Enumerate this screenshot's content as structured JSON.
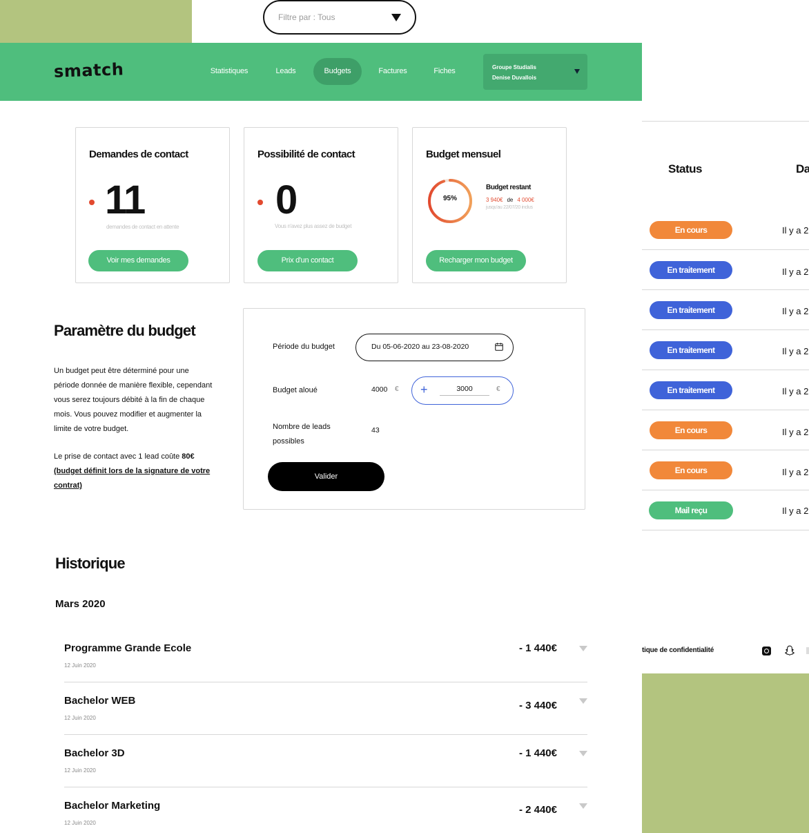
{
  "filter": {
    "placeholder": "Filtre par : Tous"
  },
  "header": {
    "logo": "smatch",
    "nav": [
      {
        "label": "Statistiques",
        "active": false
      },
      {
        "label": "Leads",
        "active": false
      },
      {
        "label": "Budgets",
        "active": true
      },
      {
        "label": "Factures",
        "active": false
      },
      {
        "label": "Fiches",
        "active": false
      }
    ],
    "account": {
      "company": "Groupe Studialis",
      "user": "Denise Duvallois"
    }
  },
  "cards": {
    "contact_requests": {
      "title": "Demandes de contact",
      "value": "11",
      "caption": "demandes de contact en attente",
      "button": "Voir mes demandes"
    },
    "contact_possibility": {
      "title": "Possibilité de contact",
      "value": "0",
      "caption": "Vous n'avez plus assez de budget",
      "button": "Prix d'un contact"
    },
    "monthly_budget": {
      "title": "Budget mensuel",
      "percent_label": "95%",
      "percent_value": 0.95,
      "remaining_label": "Budget restant",
      "remaining_amount": "3 940€",
      "of_label": "de",
      "total_amount": "4 000€",
      "until": "jusqu'au 22/07/20 inclus",
      "button": "Recharger mon budget"
    }
  },
  "budget_settings": {
    "title": "Paramètre du budget",
    "description": "Un budget peut être déterminé pour une période donnée de manière flexible, cependant vous serez toujours débité à la fin de chaque mois. Vous pouvez modifier et augmenter la limite de votre budget.",
    "cost_prefix": "Le prise de contact avec 1 lead coûte ",
    "cost_value": "80€",
    "cost_note": "(budget définit lors de la signature de votre contrat)",
    "period_label": "Période du budget",
    "period_value": "Du 05-06-2020 au 23-08-2020",
    "allocated_label": "Budget aloué",
    "allocated_value": "4000",
    "currency": "€",
    "add_value": "3000",
    "leads_label": "Nombre de leads possibles",
    "leads_value": "43",
    "submit": "Valider"
  },
  "history": {
    "title": "Historique",
    "month": "Mars 2020",
    "rows": [
      {
        "name": "Programme Grande Ecole",
        "date": "12 Juin 2020",
        "amount": "- 1 440€"
      },
      {
        "name": "Bachelor WEB",
        "date": "12 Juin 2020",
        "amount": "- 3 440€"
      },
      {
        "name": "Bachelor 3D",
        "date": "12 Juin 2020",
        "amount": "- 1 440€"
      },
      {
        "name": "Bachelor Marketing",
        "date": "12 Juin 2020",
        "amount": "- 2 440€"
      }
    ]
  },
  "status_table": {
    "status_header": "Status",
    "date_header": "Da",
    "rows": [
      {
        "status": "En cours",
        "ago": "Il y a 2"
      },
      {
        "status": "En traitement",
        "ago": "Il y a 2"
      },
      {
        "status": "En traitement",
        "ago": "Il y a 2"
      },
      {
        "status": "En traitement",
        "ago": "Il y a 2"
      },
      {
        "status": "En traitement",
        "ago": "Il y a 2"
      },
      {
        "status": "En cours",
        "ago": "Il y a 2"
      },
      {
        "status": "En cours",
        "ago": "Il y a 2"
      },
      {
        "status": "Mail reçu",
        "ago": "Il y a 2"
      }
    ]
  },
  "footer": {
    "privacy": "tique de confidentialité"
  },
  "colors": {
    "brand_green": "#4fbe7d",
    "active_nav": "#3e9f68",
    "accent_red": "#e24a2f",
    "status_en_cours": "#f1883a",
    "status_en_traitement": "#3f63d9",
    "status_mail_recu": "#4fbe7d",
    "olive_block": "#b3c47f"
  },
  "icons": {
    "filter_toggle": "triangle-down-icon",
    "calendar": "calendar-icon",
    "plus": "plus-icon",
    "expand": "chevron-down-icon",
    "instagram": "instagram-icon",
    "snapchat": "snapchat-icon"
  }
}
